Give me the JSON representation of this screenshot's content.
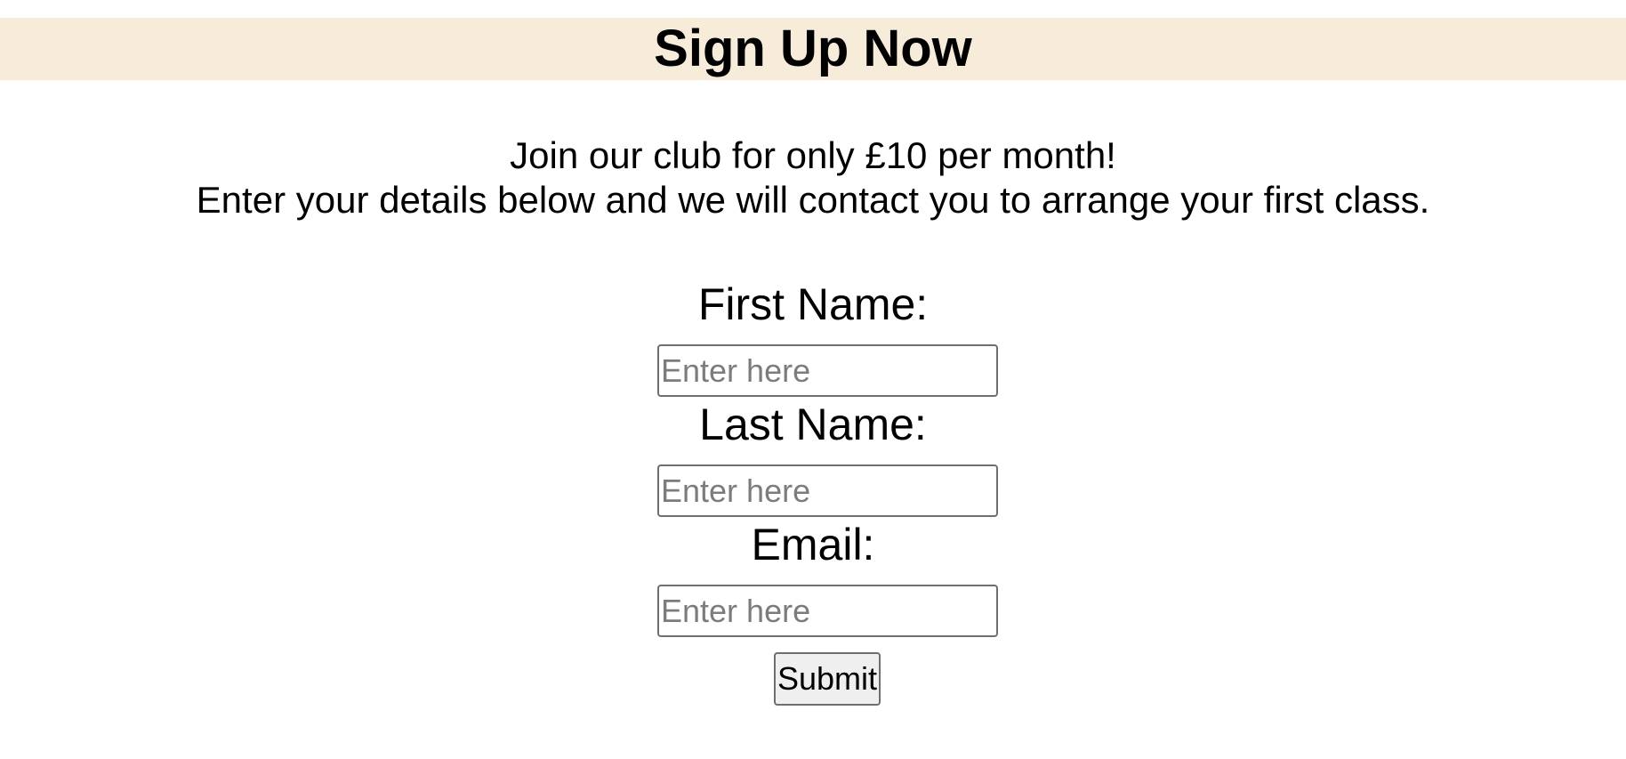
{
  "header": {
    "title": "Sign Up Now"
  },
  "intro": {
    "line1": "Join our club for only £10 per month!",
    "line2": "Enter your details below and we will contact you to arrange your first class."
  },
  "form": {
    "first_name": {
      "label": "First Name:",
      "placeholder": "Enter here",
      "value": ""
    },
    "last_name": {
      "label": "Last Name:",
      "placeholder": "Enter here",
      "value": ""
    },
    "email": {
      "label": "Email:",
      "placeholder": "Enter here",
      "value": ""
    },
    "submit_label": "Submit"
  },
  "colors": {
    "header_background": "#f7ebda",
    "placeholder_text": "#7c7c7c",
    "button_background": "#efefef"
  }
}
